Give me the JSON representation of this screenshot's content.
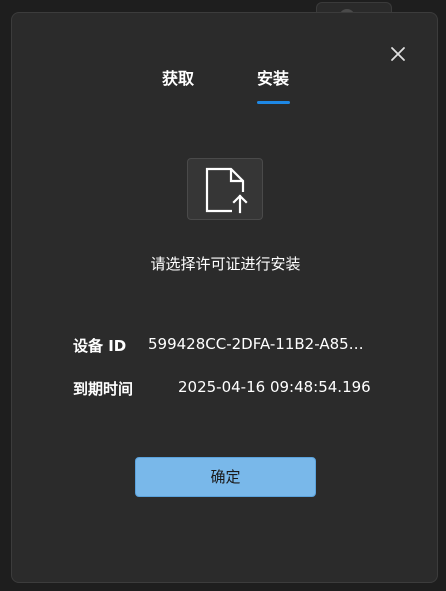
{
  "dialog": {
    "tabs": [
      {
        "label": "获取",
        "active": false
      },
      {
        "label": "安装",
        "active": true
      }
    ],
    "upload_icon": "file-upload-icon",
    "close_icon": "close-icon",
    "prompt": "请选择许可证进行安装",
    "info": {
      "device_id_label": "设备 ID",
      "device_id_value": "599428CC-2DFA-11B2-A85…",
      "expire_label": "到期时间",
      "expire_value": "2025-04-16 09:48:54.196"
    },
    "confirm_label": "确定"
  },
  "colors": {
    "dialog_bg": "#2b2b2b",
    "accent": "#1e88e5",
    "button_bg": "#79b8ea"
  }
}
